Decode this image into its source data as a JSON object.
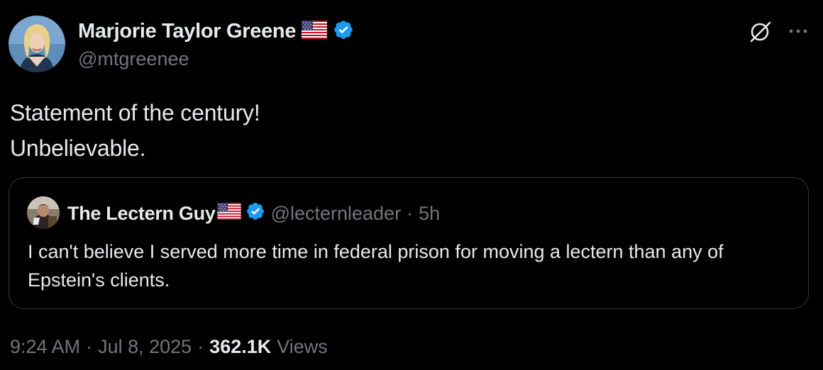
{
  "author": {
    "name": "Marjorie Taylor Greene",
    "handle": "@mtgreenee",
    "flag_icon": "us-flag-icon",
    "verified_icon": "verified-badge-icon"
  },
  "header_actions": {
    "grok_icon": "grok-icon",
    "more_icon": "more-options-icon"
  },
  "tweet": {
    "lines": [
      "Statement of the century!",
      "Unbelievable."
    ]
  },
  "quoted_tweet": {
    "name": "The Lectern Guy",
    "handle": "@lecternleader",
    "separator": "·",
    "time": "5h",
    "text": "I can't believe I served more time in federal prison for moving a lectern than any of Epstein's clients."
  },
  "meta": {
    "time": "9:24 AM",
    "separator": "·",
    "date": "Jul 8, 2025",
    "views_count": "362.1K",
    "views_label": "Views"
  },
  "colors": {
    "background": "#000000",
    "primary_text": "#e7e9ea",
    "secondary_text": "#71767b",
    "verified_blue": "#1d9bf0",
    "border": "#333639"
  }
}
